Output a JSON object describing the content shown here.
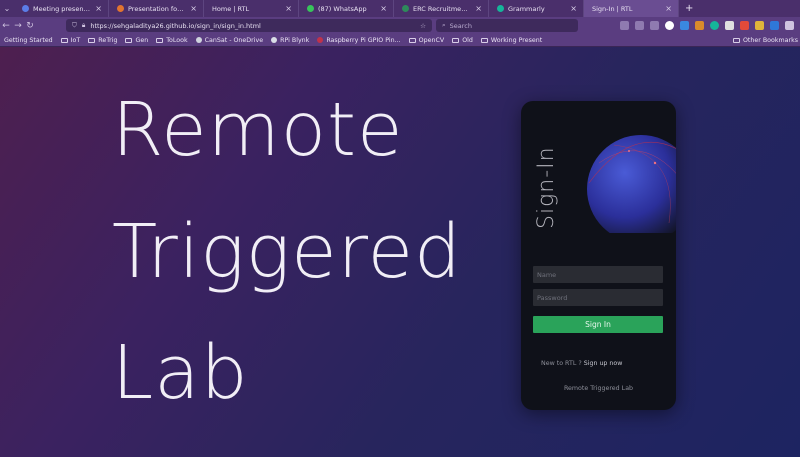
{
  "browser": {
    "tabs": [
      {
        "label": "Meeting presentations · ",
        "favicon_color": "#5b7de8",
        "active": false
      },
      {
        "label": "Presentation for Experim",
        "favicon_color": "#e2742f",
        "active": false
      },
      {
        "label": "Home | RTL",
        "favicon_color": "",
        "active": false
      },
      {
        "label": "(87) WhatsApp",
        "favicon_color": "#38c35b",
        "active": false
      },
      {
        "label": "ERC Recruitments Forms",
        "favicon_color": "#2e8a5b",
        "active": false
      },
      {
        "label": "Grammarly",
        "favicon_color": "#16b59a",
        "active": false
      },
      {
        "label": "Sign-In | RTL",
        "favicon_color": "",
        "active": true
      }
    ],
    "new_tab": "+",
    "url": "https://sehgaladitya26.github.io/sign_in/sign_in.html",
    "search_placeholder": "Search",
    "bookmarks": [
      {
        "label": "Getting Started",
        "type": "link"
      },
      {
        "label": "IoT",
        "type": "folder"
      },
      {
        "label": "ReTrig",
        "type": "folder"
      },
      {
        "label": "Gen",
        "type": "folder"
      },
      {
        "label": "ToLook",
        "type": "folder"
      },
      {
        "label": "CanSat - OneDrive",
        "type": "link"
      },
      {
        "label": "RPi Blynk",
        "type": "link"
      },
      {
        "label": "Raspberry Pi GPIO Pin...",
        "type": "link"
      },
      {
        "label": "OpenCV",
        "type": "folder"
      },
      {
        "label": "Old",
        "type": "folder"
      },
      {
        "label": "Working Present",
        "type": "folder"
      }
    ],
    "other_bookmarks": "Other Bookmarks"
  },
  "page": {
    "hero": [
      "Remote",
      "Triggered",
      "Lab"
    ],
    "card": {
      "vertical_title": "Sign-In",
      "name_placeholder": "Name",
      "password_placeholder": "Password",
      "signin_label": "Sign In",
      "signup_prefix": "New to RTL ?",
      "signup_link": "Sign up now",
      "footer": "Remote Triggered Lab"
    }
  },
  "colors": {
    "accent_green": "#2aa35a",
    "card_bg": "#0f1119",
    "chrome_purple": "#5a3d80"
  }
}
